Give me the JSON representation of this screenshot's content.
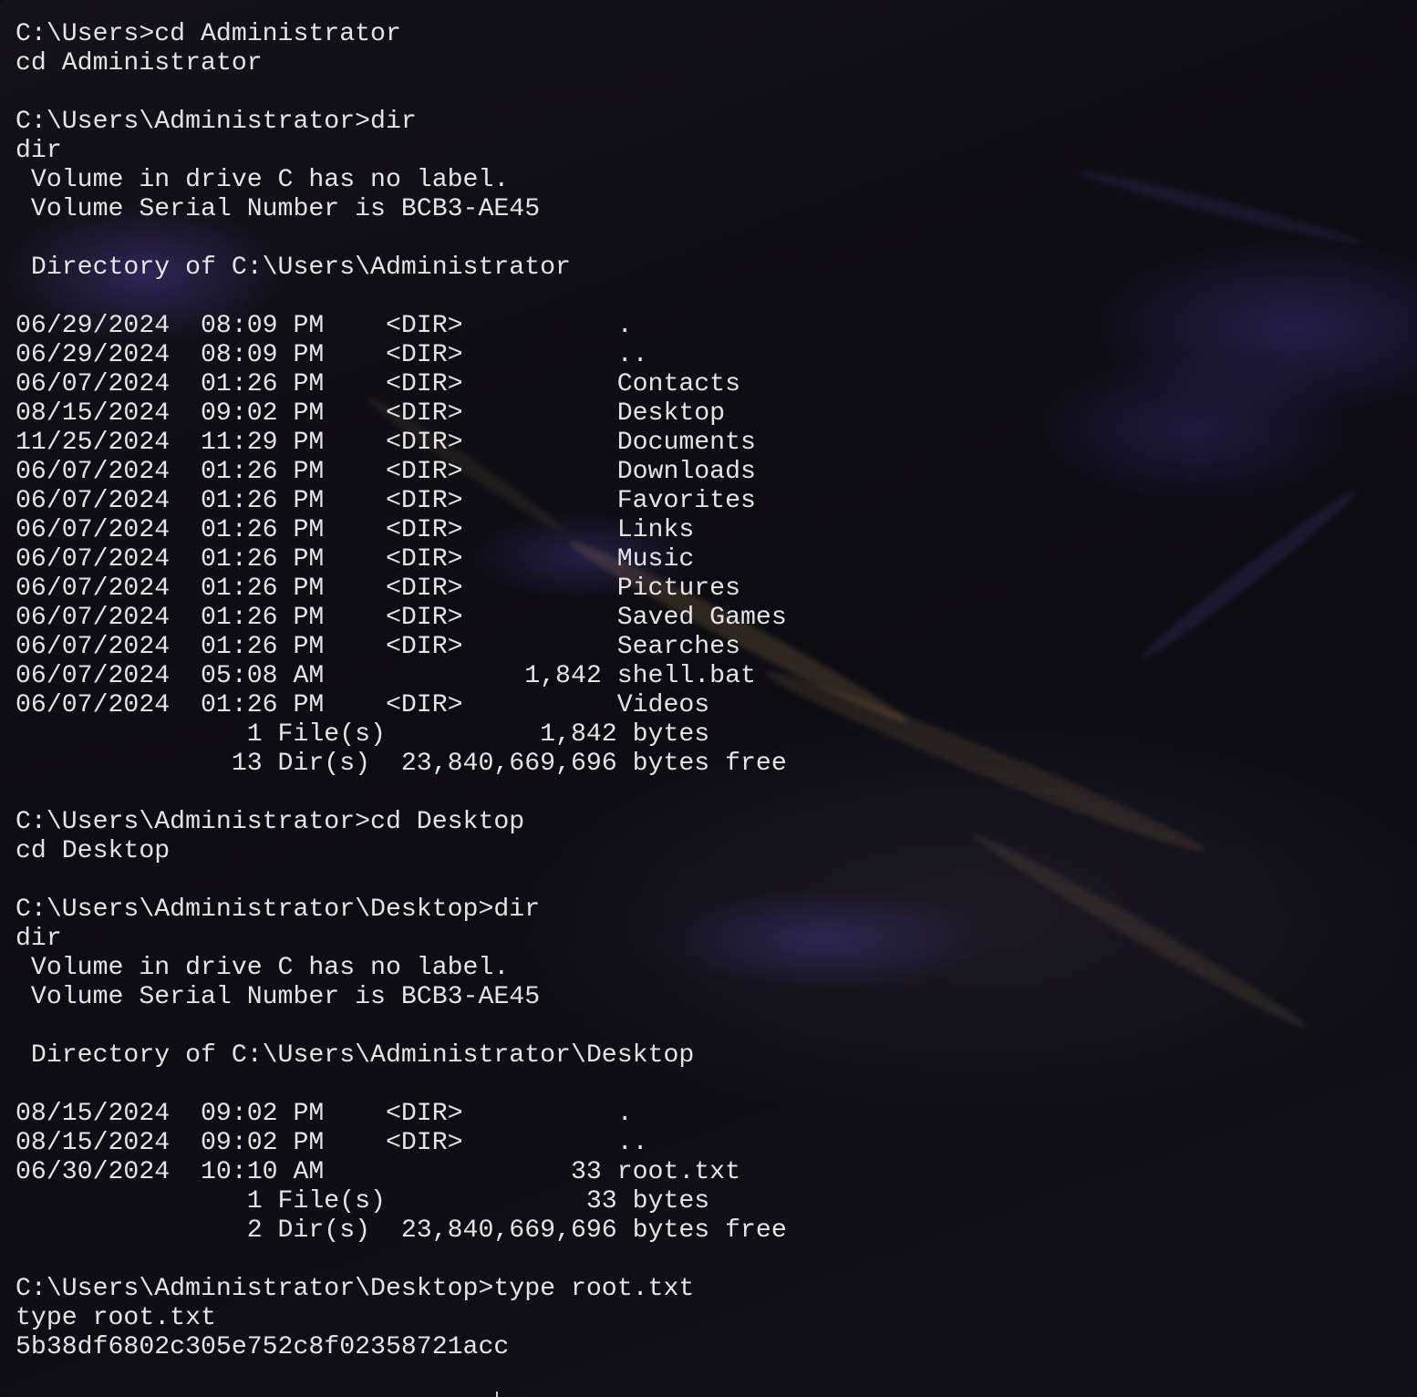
{
  "terminal": {
    "lines": [
      "C:\\Users>cd Administrator",
      "cd Administrator",
      "",
      "C:\\Users\\Administrator>dir",
      "dir",
      " Volume in drive C has no label.",
      " Volume Serial Number is BCB3-AE45",
      "",
      " Directory of C:\\Users\\Administrator",
      "",
      "06/29/2024  08:09 PM    <DIR>          .",
      "06/29/2024  08:09 PM    <DIR>          ..",
      "06/07/2024  01:26 PM    <DIR>          Contacts",
      "08/15/2024  09:02 PM    <DIR>          Desktop",
      "11/25/2024  11:29 PM    <DIR>          Documents",
      "06/07/2024  01:26 PM    <DIR>          Downloads",
      "06/07/2024  01:26 PM    <DIR>          Favorites",
      "06/07/2024  01:26 PM    <DIR>          Links",
      "06/07/2024  01:26 PM    <DIR>          Music",
      "06/07/2024  01:26 PM    <DIR>          Pictures",
      "06/07/2024  01:26 PM    <DIR>          Saved Games",
      "06/07/2024  01:26 PM    <DIR>          Searches",
      "06/07/2024  05:08 AM             1,842 shell.bat",
      "06/07/2024  01:26 PM    <DIR>          Videos",
      "               1 File(s)          1,842 bytes",
      "              13 Dir(s)  23,840,669,696 bytes free",
      "",
      "C:\\Users\\Administrator>cd Desktop",
      "cd Desktop",
      "",
      "C:\\Users\\Administrator\\Desktop>dir",
      "dir",
      " Volume in drive C has no label.",
      " Volume Serial Number is BCB3-AE45",
      "",
      " Directory of C:\\Users\\Administrator\\Desktop",
      "",
      "08/15/2024  09:02 PM    <DIR>          .",
      "08/15/2024  09:02 PM    <DIR>          ..",
      "06/30/2024  10:10 AM                33 root.txt",
      "               1 File(s)             33 bytes",
      "               2 Dir(s)  23,840,669,696 bytes free",
      "",
      "C:\\Users\\Administrator\\Desktop>type root.txt",
      "type root.txt",
      "5b38df6802c305e752c8f02358721acc",
      ""
    ]
  }
}
